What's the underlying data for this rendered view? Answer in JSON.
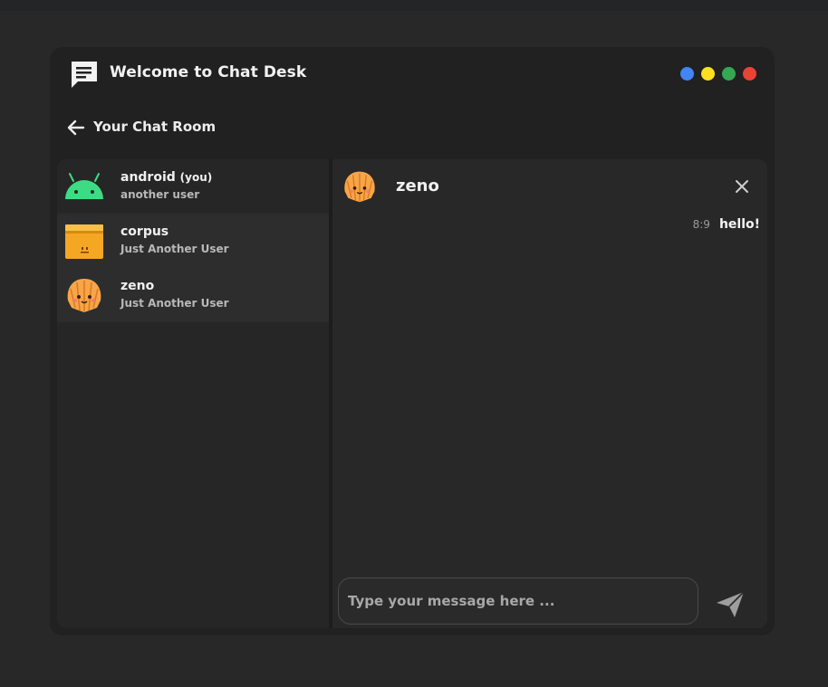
{
  "app": {
    "title": "Welcome to Chat Desk",
    "icon": "chat-icon"
  },
  "window_controls": [
    {
      "name": "blue",
      "color": "#4285f4"
    },
    {
      "name": "yellow",
      "color": "#fbe022"
    },
    {
      "name": "green",
      "color": "#34a853"
    },
    {
      "name": "red",
      "color": "#ea4335"
    }
  ],
  "room": {
    "title": "Your Chat Room",
    "back_icon": "arrow-left-icon"
  },
  "contacts": [
    {
      "name": "android",
      "tag": "(you)",
      "subtitle": "another user",
      "avatar": "android-icon"
    },
    {
      "name": "corpus",
      "tag": "",
      "subtitle": "Just Another User",
      "avatar": "box-icon"
    },
    {
      "name": "zeno",
      "tag": "",
      "subtitle": "Just Another User",
      "avatar": "shell-icon"
    }
  ],
  "chat": {
    "name": "zeno",
    "avatar": "shell-icon",
    "messages": [
      {
        "time": "8:9",
        "text": "hello!"
      }
    ],
    "composer_placeholder": "Type your message here ...",
    "composer_value": ""
  },
  "colors": {
    "accent_green": "#3ddc84",
    "window_bg": "#212121",
    "page_bg": "#282828"
  }
}
